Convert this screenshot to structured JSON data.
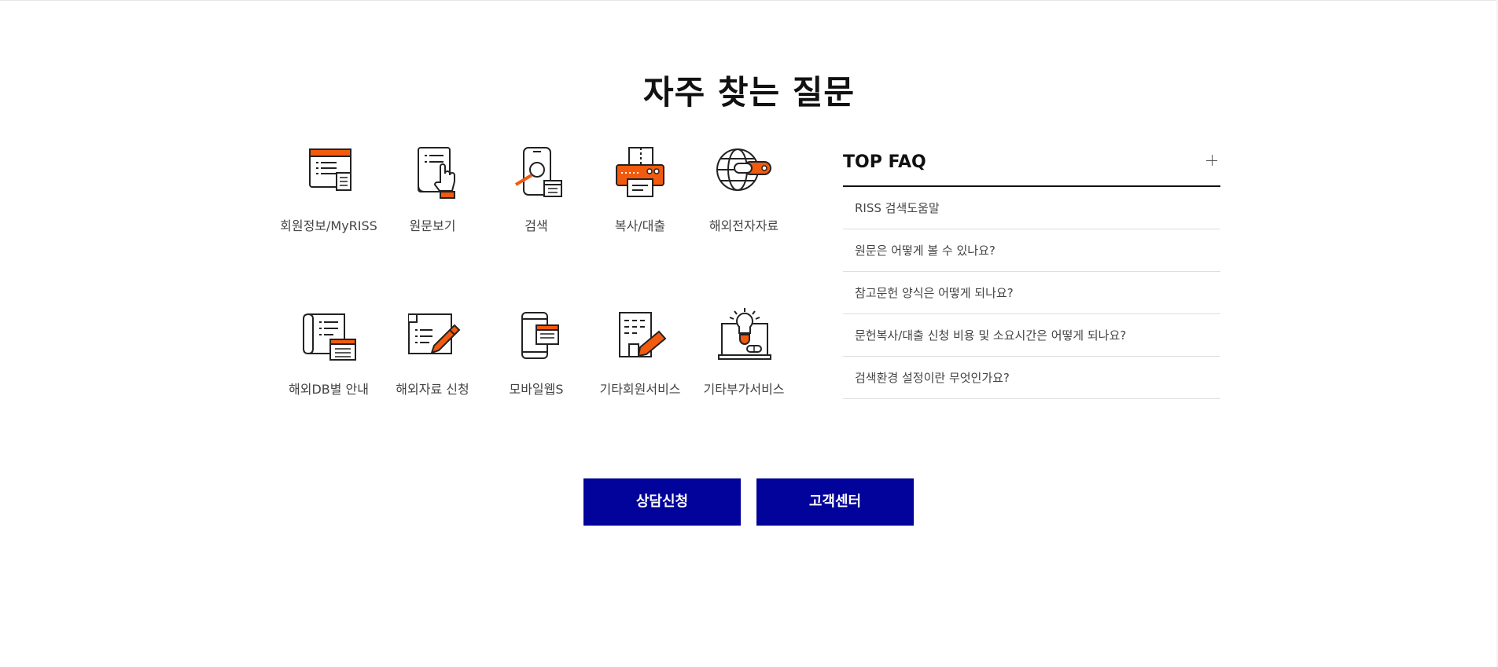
{
  "page_title": "자주 찾는 질문",
  "menu": [
    {
      "label": "회원정보/MyRISS",
      "icon": "member-info-icon"
    },
    {
      "label": "원문보기",
      "icon": "book-pointer-icon"
    },
    {
      "label": "검색",
      "icon": "mobile-search-icon"
    },
    {
      "label": "복사/대출",
      "icon": "printer-icon"
    },
    {
      "label": "해외전자자료",
      "icon": "globe-icon"
    },
    {
      "label": "해외DB별 안내",
      "icon": "scroll-document-icon"
    },
    {
      "label": "해외자료 신청",
      "icon": "form-pen-icon"
    },
    {
      "label": "모바일웹S",
      "icon": "mobile-web-icon"
    },
    {
      "label": "기타회원서비스",
      "icon": "building-pencil-icon"
    },
    {
      "label": "기타부가서비스",
      "icon": "lightbulb-board-icon"
    }
  ],
  "faq": {
    "title": "TOP FAQ",
    "items": [
      "RISS 검색도움말",
      "원문은 어떻게 볼 수 있나요?",
      "참고문헌 양식은 어떻게 되나요?",
      "문헌복사/대출 신청 비용 및 소요시간은 어떻게 되나요?",
      "검색환경 설정이란 무엇인가요?"
    ]
  },
  "buttons": {
    "consult": "상담신청",
    "customer_center": "고객센터"
  },
  "colors": {
    "accent": "#f25a0e",
    "button": "#02039a",
    "line": "#222222"
  }
}
